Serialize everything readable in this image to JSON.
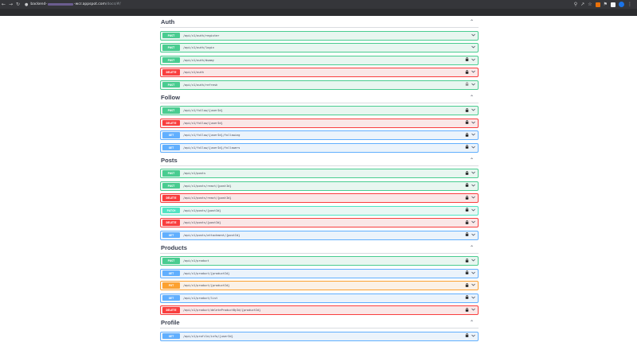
{
  "browser": {
    "url_host": "backend-",
    "url_host_rest": "-wcr.appspot.com",
    "url_path": "/docs/#/"
  },
  "sections": [
    {
      "title": "Auth",
      "ops": [
        {
          "method": "POST",
          "path": "/api/v1/auth/register",
          "lock": "none"
        },
        {
          "method": "POST",
          "path": "/api/v1/auth/login",
          "lock": "none"
        },
        {
          "method": "POST",
          "path": "/api/v1/auth/dummy",
          "lock": "locked"
        },
        {
          "method": "DELETE",
          "path": "/api/v1/auth",
          "lock": "locked"
        },
        {
          "method": "POST",
          "path": "/api/v1/auth/refresh",
          "lock": "unlocked"
        }
      ]
    },
    {
      "title": "Follow",
      "ops": [
        {
          "method": "POST",
          "path": "/api/v1/follow/{userId}",
          "lock": "locked"
        },
        {
          "method": "DELETE",
          "path": "/api/v1/follow/{userId}",
          "lock": "locked"
        },
        {
          "method": "GET",
          "path": "/api/v1/follow/{userId}/following",
          "lock": "locked"
        },
        {
          "method": "GET",
          "path": "/api/v1/follow/{userId}/followers",
          "lock": "locked"
        }
      ]
    },
    {
      "title": "Posts",
      "ops": [
        {
          "method": "POST",
          "path": "/api/v1/posts",
          "lock": "locked"
        },
        {
          "method": "POST",
          "path": "/api/v1/posts/react/{postId}",
          "lock": "locked"
        },
        {
          "method": "DELETE",
          "path": "/api/v1/posts/react/{postId}",
          "lock": "locked"
        },
        {
          "method": "PATCH",
          "path": "/api/v1/posts/{postId}",
          "lock": "locked"
        },
        {
          "method": "DELETE",
          "path": "/api/v1/posts/{postId}",
          "lock": "locked"
        },
        {
          "method": "GET",
          "path": "/api/v1/posts/attachment/{postId}",
          "lock": "locked"
        }
      ]
    },
    {
      "title": "Products",
      "ops": [
        {
          "method": "POST",
          "path": "/api/v1/product",
          "lock": "locked"
        },
        {
          "method": "GET",
          "path": "/api/v1/product/{productId}",
          "lock": "locked"
        },
        {
          "method": "PUT",
          "path": "/api/v1/product/{productId}",
          "lock": "locked"
        },
        {
          "method": "GET",
          "path": "/api/v1/product/list",
          "lock": "locked"
        },
        {
          "method": "DELETE",
          "path": "/api/v1/product/deleteProductById/{productId}",
          "lock": "locked"
        }
      ]
    },
    {
      "title": "Profile",
      "ops": [
        {
          "method": "GET",
          "path": "/api/v1/profile/info/{userId}",
          "lock": "locked"
        }
      ]
    }
  ],
  "icons": {
    "collapse": "chevron-up-icon",
    "expand": "chevron-down-icon",
    "lock": "lock-icon"
  },
  "colors": {
    "post": "#49cc90",
    "delete": "#f93e3e",
    "get": "#61affe",
    "patch": "#50e3c2",
    "put": "#fca130"
  }
}
